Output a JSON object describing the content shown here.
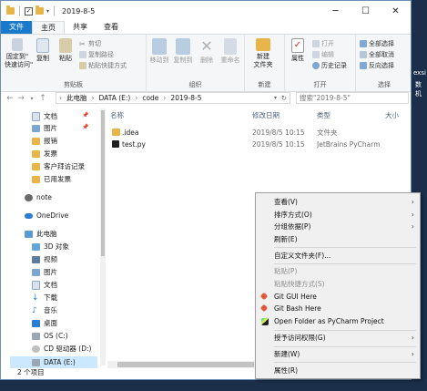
{
  "window": {
    "title": "2019-8-5",
    "controls": {
      "minimize": "─",
      "maximize": "☐",
      "close": "✕"
    }
  },
  "ribbon_tabs": [
    "文件",
    "主页",
    "共享",
    "查看"
  ],
  "ribbon": {
    "clipboard": {
      "pin": "固定到\"\n快速访问\"",
      "copy": "复制",
      "paste": "粘贴",
      "cut": "剪切",
      "copy_path": "复制路径",
      "paste_shortcut": "粘贴快捷方式",
      "label": "剪贴板"
    },
    "organize": {
      "move_to": "移动到",
      "copy_to": "复制到",
      "delete": "删除",
      "rename": "重命名",
      "label": "组织"
    },
    "new": {
      "new_folder": "新建\n文件夹",
      "label": "新建"
    },
    "open": {
      "properties": "属性",
      "open": "打开",
      "edit": "编辑",
      "history": "历史记录",
      "label": "打开"
    },
    "select": {
      "select_all": "全部选择",
      "select_none": "全部取消",
      "invert": "反向选择",
      "label": "选择"
    }
  },
  "address": {
    "crumbs": [
      "此电脑",
      "DATA (E:)",
      "code",
      "2019-8-5"
    ],
    "search_placeholder": "搜索\"2019-8-5\""
  },
  "nav_items": [
    {
      "label": "文档",
      "pinned": true
    },
    {
      "label": "图片",
      "pinned": true
    },
    {
      "label": "报销"
    },
    {
      "label": "发票"
    },
    {
      "label": "客户拜访记录"
    },
    {
      "label": "已用发票"
    },
    {
      "label": "note"
    },
    {
      "label": "OneDrive"
    },
    {
      "label": "此电脑"
    },
    {
      "label": "3D 对象"
    },
    {
      "label": "视频"
    },
    {
      "label": "图片"
    },
    {
      "label": "文档"
    },
    {
      "label": "下载"
    },
    {
      "label": "音乐"
    },
    {
      "label": "桌面"
    },
    {
      "label": "OS (C:)"
    },
    {
      "label": "CD 驱动器 (D:)"
    },
    {
      "label": "DATA (E:)"
    }
  ],
  "columns": {
    "name": "名称",
    "date": "修改日期",
    "type": "类型",
    "size": "大小"
  },
  "files": [
    {
      "name": ".idea",
      "date": "2019/8/5 10:15",
      "type": "文件夹"
    },
    {
      "name": "test.py",
      "date": "2019/8/5 10:15",
      "type": "JetBrains PyCharm"
    }
  ],
  "status": "2 个项目",
  "context_menu": [
    {
      "label": "查看(V)",
      "submenu": true
    },
    {
      "label": "排序方式(O)",
      "submenu": true
    },
    {
      "label": "分组依据(P)",
      "submenu": true
    },
    {
      "label": "刷新(E)"
    },
    {
      "sep": true
    },
    {
      "label": "自定义文件夹(F)..."
    },
    {
      "sep": true
    },
    {
      "label": "粘贴(P)",
      "disabled": true
    },
    {
      "label": "粘贴快捷方式(S)",
      "disabled": true
    },
    {
      "label": "Git GUI Here",
      "icon": "git-gui-icon"
    },
    {
      "label": "Git Bash Here",
      "icon": "git-bash-icon"
    },
    {
      "label": "Open Folder as PyCharm Project",
      "icon": "pycharm-icon"
    },
    {
      "sep": true
    },
    {
      "label": "授予访问权限(G)",
      "submenu": true
    },
    {
      "sep": true
    },
    {
      "label": "新建(W)",
      "submenu": true
    },
    {
      "sep": true
    },
    {
      "label": "属性(R)"
    }
  ],
  "desktop_text": [
    "exsi",
    "数机"
  ]
}
